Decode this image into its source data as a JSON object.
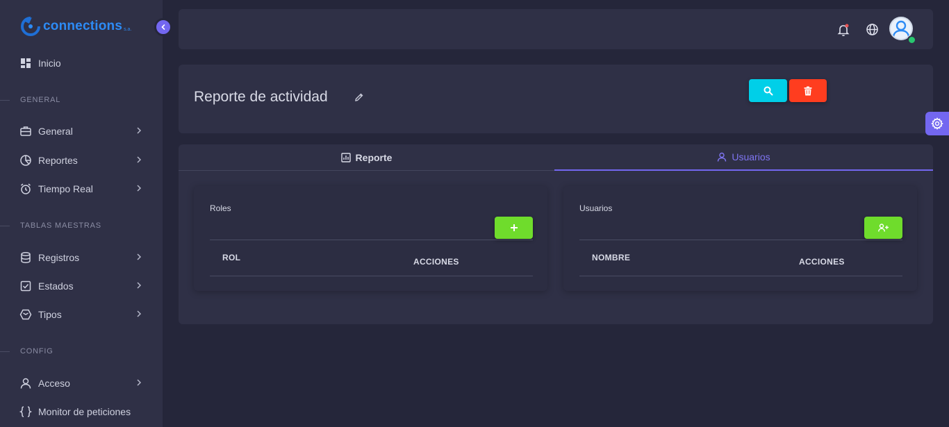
{
  "app": {
    "logo_text": "connections",
    "logo_suffix": "s.a."
  },
  "sidebar": {
    "home": "Inicio",
    "sections": {
      "general": "GENERAL",
      "tablas": "TABLAS MAESTRAS",
      "config": "CONFIG"
    },
    "items": [
      {
        "label": "General"
      },
      {
        "label": "Reportes"
      },
      {
        "label": "Tiempo Real"
      },
      {
        "label": "Registros"
      },
      {
        "label": "Estados"
      },
      {
        "label": "Tipos"
      },
      {
        "label": "Acceso"
      },
      {
        "label": "Monitor de peticiones"
      }
    ]
  },
  "header": {
    "title": "Reporte de actividad"
  },
  "tabs": [
    {
      "label": "Reporte",
      "active": false
    },
    {
      "label": "Usuarios",
      "active": true
    }
  ],
  "panels": {
    "roles": {
      "title": "Roles",
      "columns": [
        "ROL",
        "ACCIONES"
      ]
    },
    "usuarios": {
      "title": "Usuarios",
      "columns": [
        "NOMBRE",
        "ACCIONES"
      ]
    }
  },
  "colors": {
    "accent": "#7367f0",
    "search": "#00cfe8",
    "delete": "#ff3d1f",
    "add": "#6fdc2c",
    "status_online": "#28c76f"
  },
  "icons": {
    "top": [
      "bell-icon",
      "globe-icon",
      "user-avatar"
    ],
    "header": [
      "edit-icon",
      "search-icon",
      "trash-icon"
    ]
  }
}
